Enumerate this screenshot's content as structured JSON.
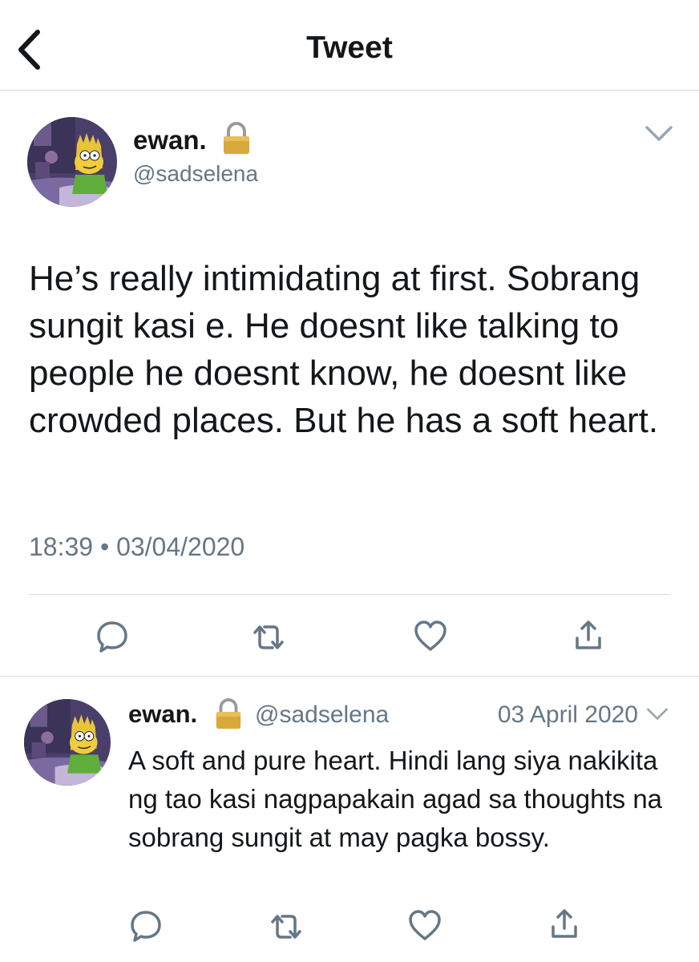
{
  "header": {
    "title": "Tweet"
  },
  "tweet": {
    "name": "ewan.",
    "handle": "@sadselena",
    "text": "He’s really intimidating at first. Sobrang sungit kasi e. He doesnt like talking to people he doesnt know, he doesnt like crowded places. But he has a soft heart.",
    "timestamp": "18:39 • 03/04/2020"
  },
  "reply": {
    "name": "ewan.",
    "handle": "@sadselena",
    "date": "03 April 2020",
    "text": "A soft and pure heart. Hindi lang siya nakikita ng tao kasi nagpapakain agad sa thoughts na sobrang sungit at may pagka bossy."
  },
  "icons": {
    "back": "chevron-left-icon",
    "lock": "lock-icon",
    "menu": "chevron-down-icon",
    "reply": "reply-icon",
    "retweet": "retweet-icon",
    "like": "heart-icon",
    "share": "share-icon"
  },
  "colors": {
    "text": "#14171a",
    "secondary": "#657786",
    "divider": "#d6dadd",
    "icon": "#657786"
  }
}
